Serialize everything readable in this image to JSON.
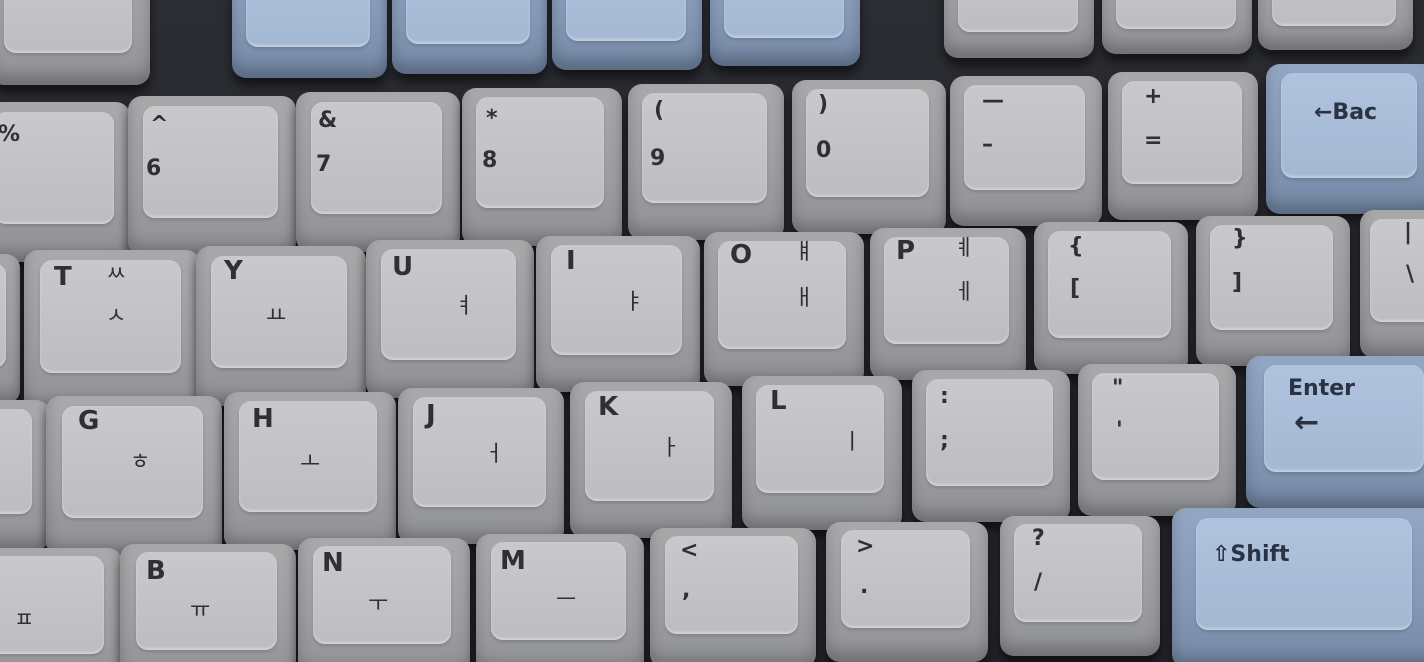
{
  "keyboard": {
    "number_row": [
      {
        "shift": "%",
        "base": ""
      },
      {
        "shift": "^",
        "base": "6"
      },
      {
        "shift": "&",
        "base": "7"
      },
      {
        "shift": "*",
        "base": "8"
      },
      {
        "shift": "(",
        "base": "9"
      },
      {
        "shift": ")",
        "base": "0"
      },
      {
        "shift": "—",
        "base": "–"
      },
      {
        "shift": "+",
        "base": "="
      }
    ],
    "backspace_label": "←Bac",
    "top_row": [
      {
        "legend": "T",
        "hangul_shift": "ㅆ",
        "hangul": "ㅅ"
      },
      {
        "legend": "Y",
        "hangul_shift": "",
        "hangul": "ㅛ"
      },
      {
        "legend": "U",
        "hangul_shift": "",
        "hangul": "ㅕ"
      },
      {
        "legend": "I",
        "hangul_shift": "",
        "hangul": "ㅑ"
      },
      {
        "legend": "O",
        "hangul_shift": "ㅒ",
        "hangul": "ㅐ"
      },
      {
        "legend": "P",
        "hangul_shift": "ㅖ",
        "hangul": "ㅔ"
      },
      {
        "legend": "{",
        "hangul_shift": "",
        "hangul": "["
      },
      {
        "legend": "}",
        "hangul_shift": "",
        "hangul": "]"
      },
      {
        "legend": "|",
        "hangul_shift": "",
        "hangul": "\\"
      }
    ],
    "home_row": [
      {
        "legend": "G",
        "hangul": "ㅎ"
      },
      {
        "legend": "H",
        "hangul": "ㅗ"
      },
      {
        "legend": "J",
        "hangul": "ㅓ"
      },
      {
        "legend": "K",
        "hangul": "ㅏ"
      },
      {
        "legend": "L",
        "hangul": "ㅣ"
      },
      {
        "legend": ":",
        "hangul": ";"
      },
      {
        "legend": "\"",
        "hangul": "'"
      }
    ],
    "enter_label": "Enter",
    "enter_arrow": "←",
    "bottom_row": [
      {
        "legend": "",
        "hangul": "ㅍ"
      },
      {
        "legend": "B",
        "hangul": "ㅠ"
      },
      {
        "legend": "N",
        "hangul": "ㅜ"
      },
      {
        "legend": "M",
        "hangul": "ㅡ"
      },
      {
        "legend": "<",
        "hangul": ","
      },
      {
        "legend": ">",
        "hangul": "."
      },
      {
        "legend": "?",
        "hangul": "/"
      }
    ],
    "shift_label": "⇧Shift",
    "colors": {
      "grey_key": "#bdbdc0",
      "blue_key": "#a5b8d3",
      "case": "#25272d",
      "legend": "#2f3035"
    }
  }
}
